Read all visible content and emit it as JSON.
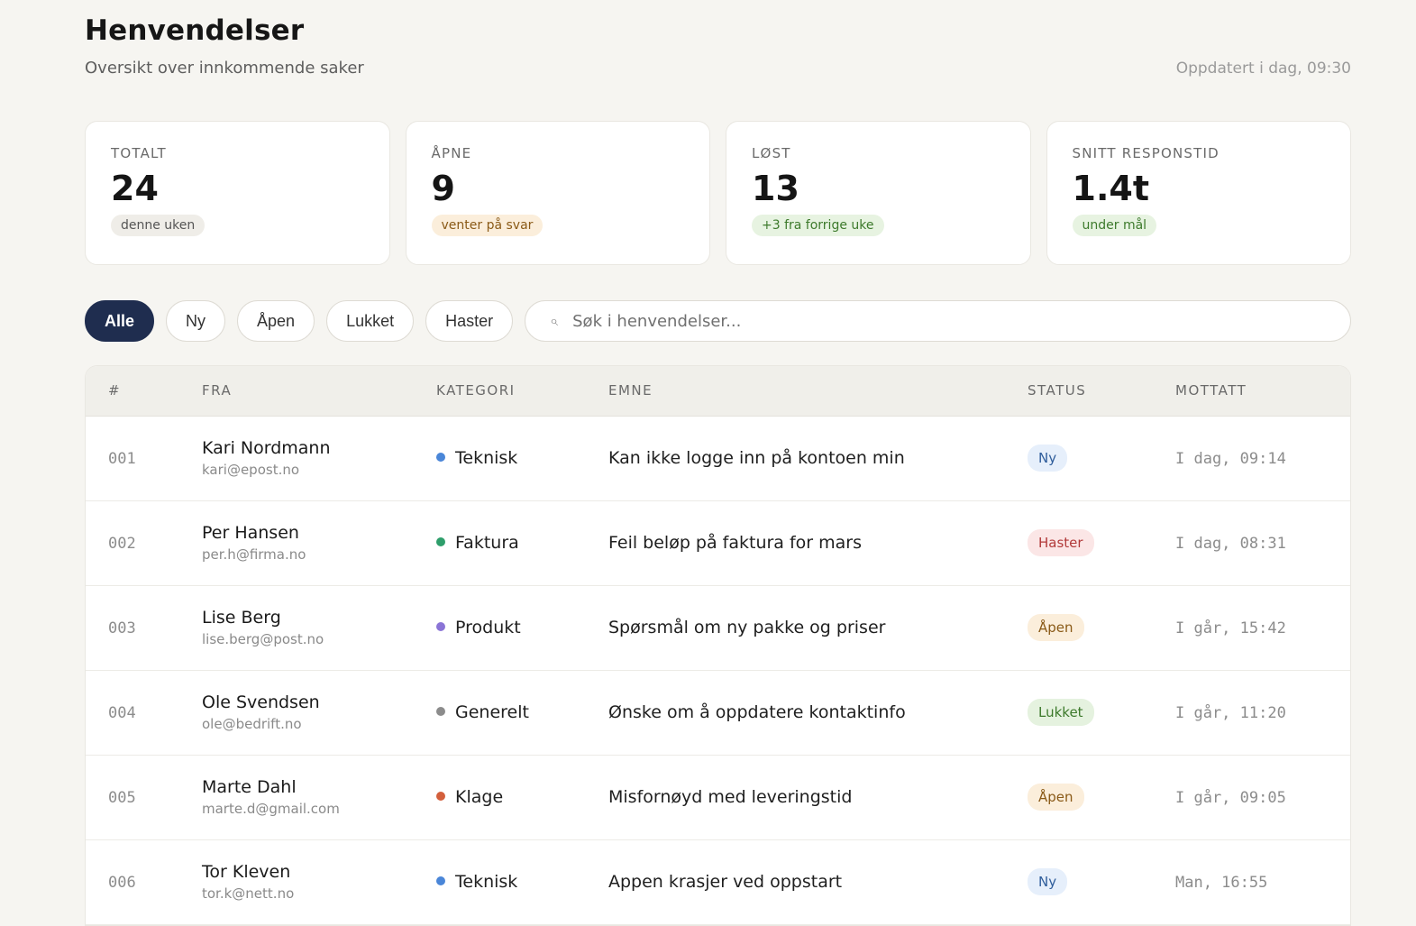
{
  "header": {
    "title": "Henvendelser",
    "subtitle": "Oversikt over innkommende saker",
    "updated": "Oppdatert i dag, 09:30"
  },
  "stats": [
    {
      "label": "TOTALT",
      "value": "24",
      "pill": "denne uken",
      "tone": "neutral"
    },
    {
      "label": "ÅPNE",
      "value": "9",
      "pill": "venter på svar",
      "tone": "amber"
    },
    {
      "label": "LØST",
      "value": "13",
      "pill": "+3 fra forrige uke",
      "tone": "green"
    },
    {
      "label": "SNITT RESPONSTID",
      "value": "1.4t",
      "pill": "under mål",
      "tone": "green"
    }
  ],
  "filters": {
    "chips": [
      "Alle",
      "Ny",
      "Åpen",
      "Lukket",
      "Haster"
    ],
    "active": "Alle",
    "search_placeholder": "Søk i henvendelser..."
  },
  "table": {
    "columns": [
      "#",
      "FRA",
      "KATEGORI",
      "EMNE",
      "STATUS",
      "MOTTATT"
    ],
    "rows": [
      {
        "id": "001",
        "name": "Kari Nordmann",
        "email": "kari@epost.no",
        "category": "Teknisk",
        "subject": "Kan ikke logge inn på kontoen min",
        "status": "Ny",
        "received": "I dag, 09:14"
      },
      {
        "id": "002",
        "name": "Per Hansen",
        "email": "per.h@firma.no",
        "category": "Faktura",
        "subject": "Feil beløp på faktura for mars",
        "status": "Haster",
        "received": "I dag, 08:31"
      },
      {
        "id": "003",
        "name": "Lise Berg",
        "email": "lise.berg@post.no",
        "category": "Produkt",
        "subject": "Spørsmål om ny pakke og priser",
        "status": "Åpen",
        "received": "I går, 15:42"
      },
      {
        "id": "004",
        "name": "Ole Svendsen",
        "email": "ole@bedrift.no",
        "category": "Generelt",
        "subject": "Ønske om å oppdatere kontaktinfo",
        "status": "Lukket",
        "received": "I går, 11:20"
      },
      {
        "id": "005",
        "name": "Marte Dahl",
        "email": "marte.d@gmail.com",
        "category": "Klage",
        "subject": "Misfornøyd med leveringstid",
        "status": "Åpen",
        "received": "I går, 09:05"
      },
      {
        "id": "006",
        "name": "Tor Kleven",
        "email": "tor.k@nett.no",
        "category": "Teknisk",
        "subject": "Appen krasjer ved oppstart",
        "status": "Ny",
        "received": "Man, 16:55"
      }
    ]
  },
  "colors": {
    "accent": "#1f2d4f",
    "category": {
      "Teknisk": "#4a86d8",
      "Faktura": "#2e9e6b",
      "Produkt": "#8a74d6",
      "Generelt": "#8c8c8c",
      "Klage": "#d35f3c"
    },
    "status": {
      "Ny": {
        "bg": "#e6effb",
        "fg": "#2f5d9b"
      },
      "Haster": {
        "bg": "#fbe6e6",
        "fg": "#b23a3a"
      },
      "Åpen": {
        "bg": "#fbeedb",
        "fg": "#8a5a17"
      },
      "Lukket": {
        "bg": "#e5f2df",
        "fg": "#3d7a2c"
      }
    }
  },
  "icons": {
    "search": "search-icon"
  }
}
